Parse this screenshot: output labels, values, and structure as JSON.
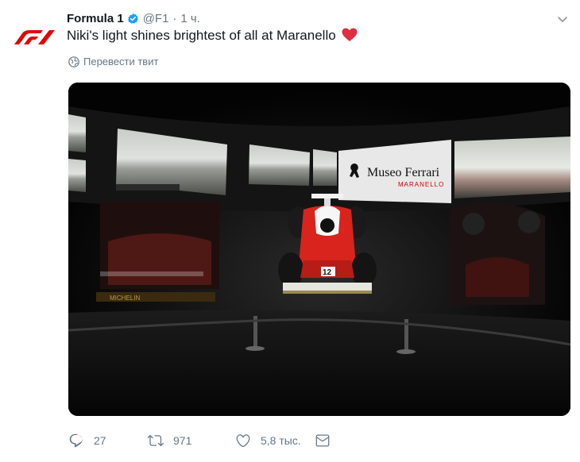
{
  "tweet": {
    "author": "Formula 1",
    "handle": "@F1",
    "separator": "·",
    "time": "1 ч.",
    "text": "Niki's light shines brightest of all at Maranello",
    "emoji": "heart-emoji",
    "translate_label": "Перевести твит"
  },
  "media": {
    "sign_line1": "Museo Ferrari",
    "sign_line2": "MARANELLO",
    "car_number": "12",
    "plaque_text": "MICHELIN"
  },
  "actions": {
    "replies": "27",
    "retweets": "971",
    "likes": "5,8 тыс."
  },
  "colors": {
    "f1_red": "#e10600",
    "verified_blue": "#1da1f2",
    "secondary_text": "#657786",
    "heart_red": "#e0245e"
  }
}
